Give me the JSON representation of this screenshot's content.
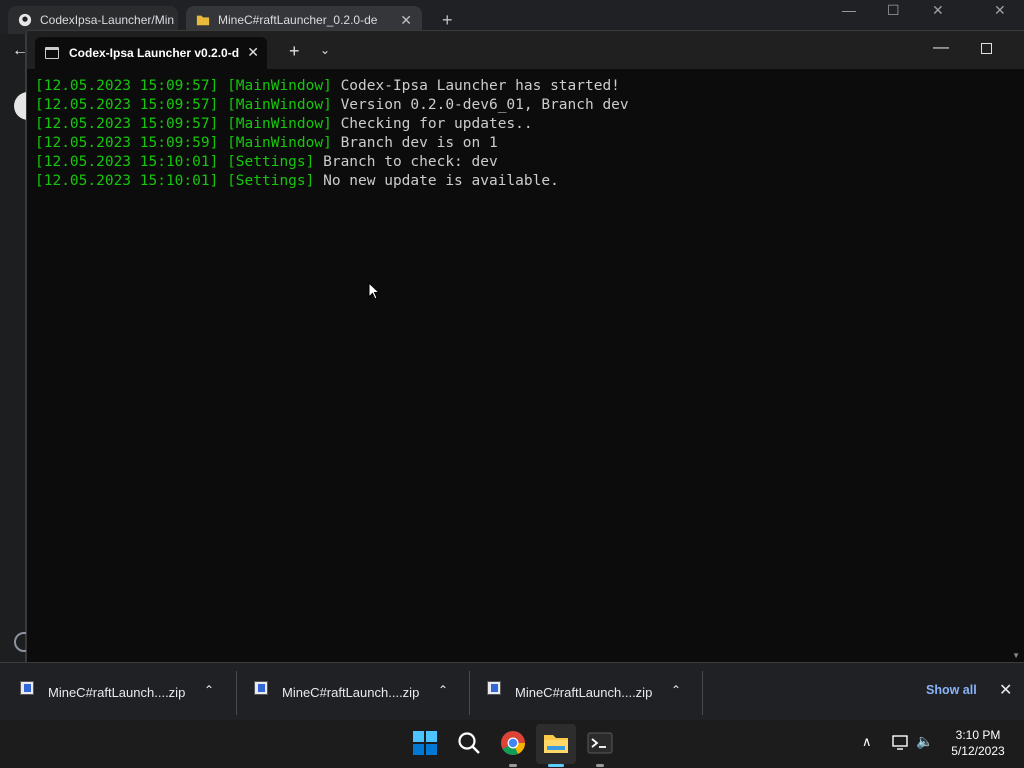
{
  "browser": {
    "tabs": [
      {
        "title": "CodexIpsa-Launcher/Min"
      },
      {
        "title": "MineC#raftLauncher_0.2.0-de"
      }
    ],
    "new_tab_icon": "plus-icon"
  },
  "terminal": {
    "tab_title": "Codex-Ipsa Launcher v0.2.0-d",
    "new_tab_icon": "plus-icon",
    "dropdown_icon": "chevron-down-icon",
    "log": [
      {
        "time": "[12.05.2023 15:09:57]",
        "source": "[MainWindow]",
        "message": "Codex-Ipsa Launcher has started!"
      },
      {
        "time": "[12.05.2023 15:09:57]",
        "source": "[MainWindow]",
        "message": "Version 0.2.0-dev6_01, Branch dev"
      },
      {
        "time": "[12.05.2023 15:09:57]",
        "source": "[MainWindow]",
        "message": "Checking for updates.."
      },
      {
        "time": "[12.05.2023 15:09:59]",
        "source": "[MainWindow]",
        "message": "Branch dev is on 1"
      },
      {
        "time": "[12.05.2023 15:10:01]",
        "source": "[Settings]",
        "message": "Branch to check: dev"
      },
      {
        "time": "[12.05.2023 15:10:01]",
        "source": "[Settings]",
        "message": "No new update is available."
      }
    ],
    "colors": {
      "log_prefix": "#16c60c",
      "text": "#cccccc",
      "background": "#0c0c0c"
    }
  },
  "downloads": {
    "items": [
      {
        "filename": "MineC#raftLaunch....zip"
      },
      {
        "filename": "MineC#raftLaunch....zip"
      },
      {
        "filename": "MineC#raftLaunch....zip"
      }
    ],
    "show_all_label": "Show all"
  },
  "taskbar": {
    "apps": [
      "start-icon",
      "search-icon",
      "chrome-icon",
      "file-explorer-icon",
      "terminal-icon"
    ],
    "clock_time": "3:10 PM",
    "clock_date": "5/12/2023"
  }
}
